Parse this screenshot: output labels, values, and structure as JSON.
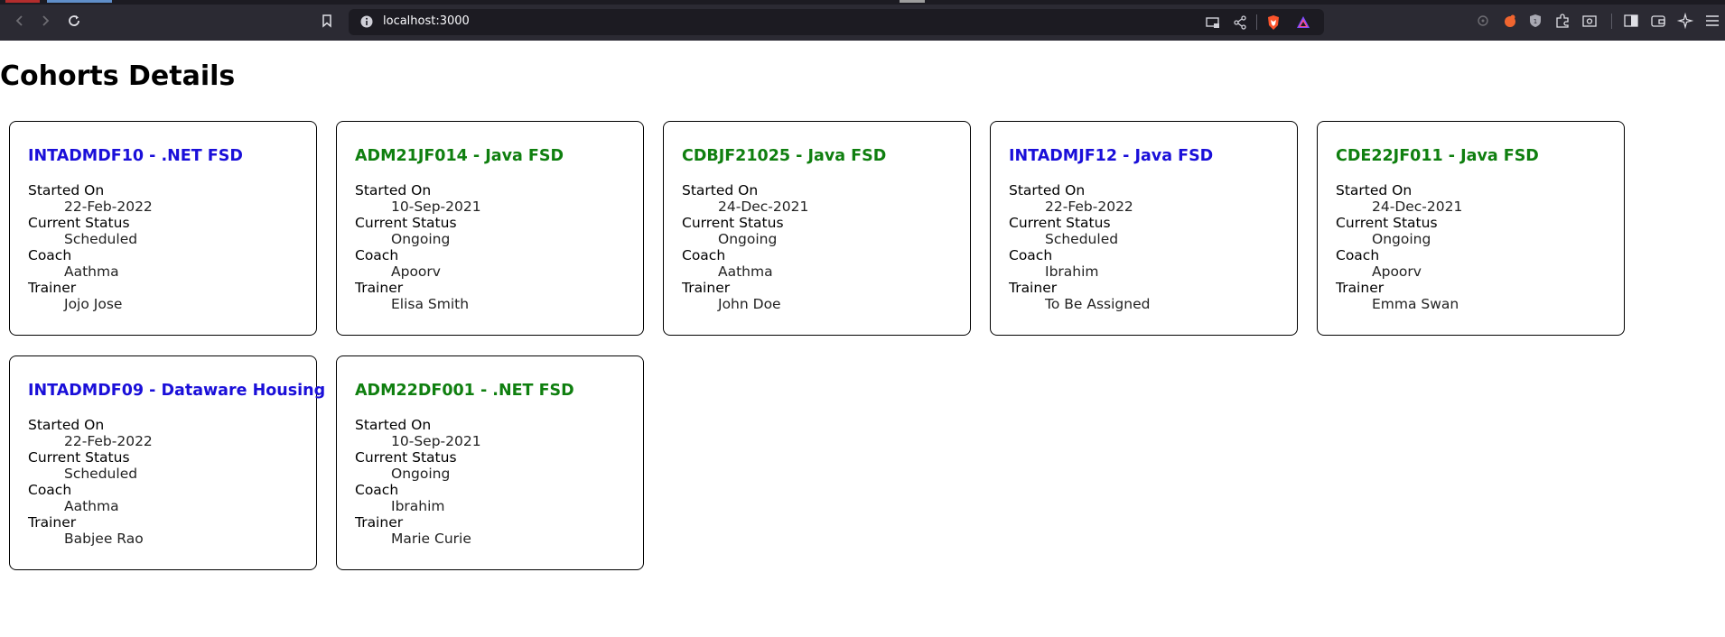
{
  "browser": {
    "url": "localhost:3000"
  },
  "page": {
    "title": "Cohorts Details"
  },
  "labels": {
    "started_on": "Started On",
    "current_status": "Current Status",
    "coach": "Coach",
    "trainer": "Trainer"
  },
  "colors": {
    "blue_title": "#1a0fd9",
    "green_title": "#0f7f0f"
  },
  "cohorts": [
    {
      "title": "INTADMDF10 - .NET FSD",
      "color": "blue",
      "started_on": "22-Feb-2022",
      "status": "Scheduled",
      "coach": "Aathma",
      "trainer": "Jojo Jose"
    },
    {
      "title": "ADM21JF014 - Java FSD",
      "color": "green",
      "started_on": "10-Sep-2021",
      "status": "Ongoing",
      "coach": "Apoorv",
      "trainer": "Elisa Smith"
    },
    {
      "title": "CDBJF21025 - Java FSD",
      "color": "green",
      "started_on": "24-Dec-2021",
      "status": "Ongoing",
      "coach": "Aathma",
      "trainer": "John Doe"
    },
    {
      "title": "INTADMJF12 - Java FSD",
      "color": "blue",
      "started_on": "22-Feb-2022",
      "status": "Scheduled",
      "coach": "Ibrahim",
      "trainer": "To Be Assigned"
    },
    {
      "title": "CDE22JF011 - Java FSD",
      "color": "green",
      "started_on": "24-Dec-2021",
      "status": "Ongoing",
      "coach": "Apoorv",
      "trainer": "Emma Swan"
    },
    {
      "title": "INTADMDF09 - Dataware Housing",
      "color": "blue",
      "started_on": "22-Feb-2022",
      "status": "Scheduled",
      "coach": "Aathma",
      "trainer": "Babjee Rao"
    },
    {
      "title": "ADM22DF001 - .NET FSD",
      "color": "green",
      "started_on": "10-Sep-2021",
      "status": "Ongoing",
      "coach": "Ibrahim",
      "trainer": "Marie Curie"
    }
  ]
}
